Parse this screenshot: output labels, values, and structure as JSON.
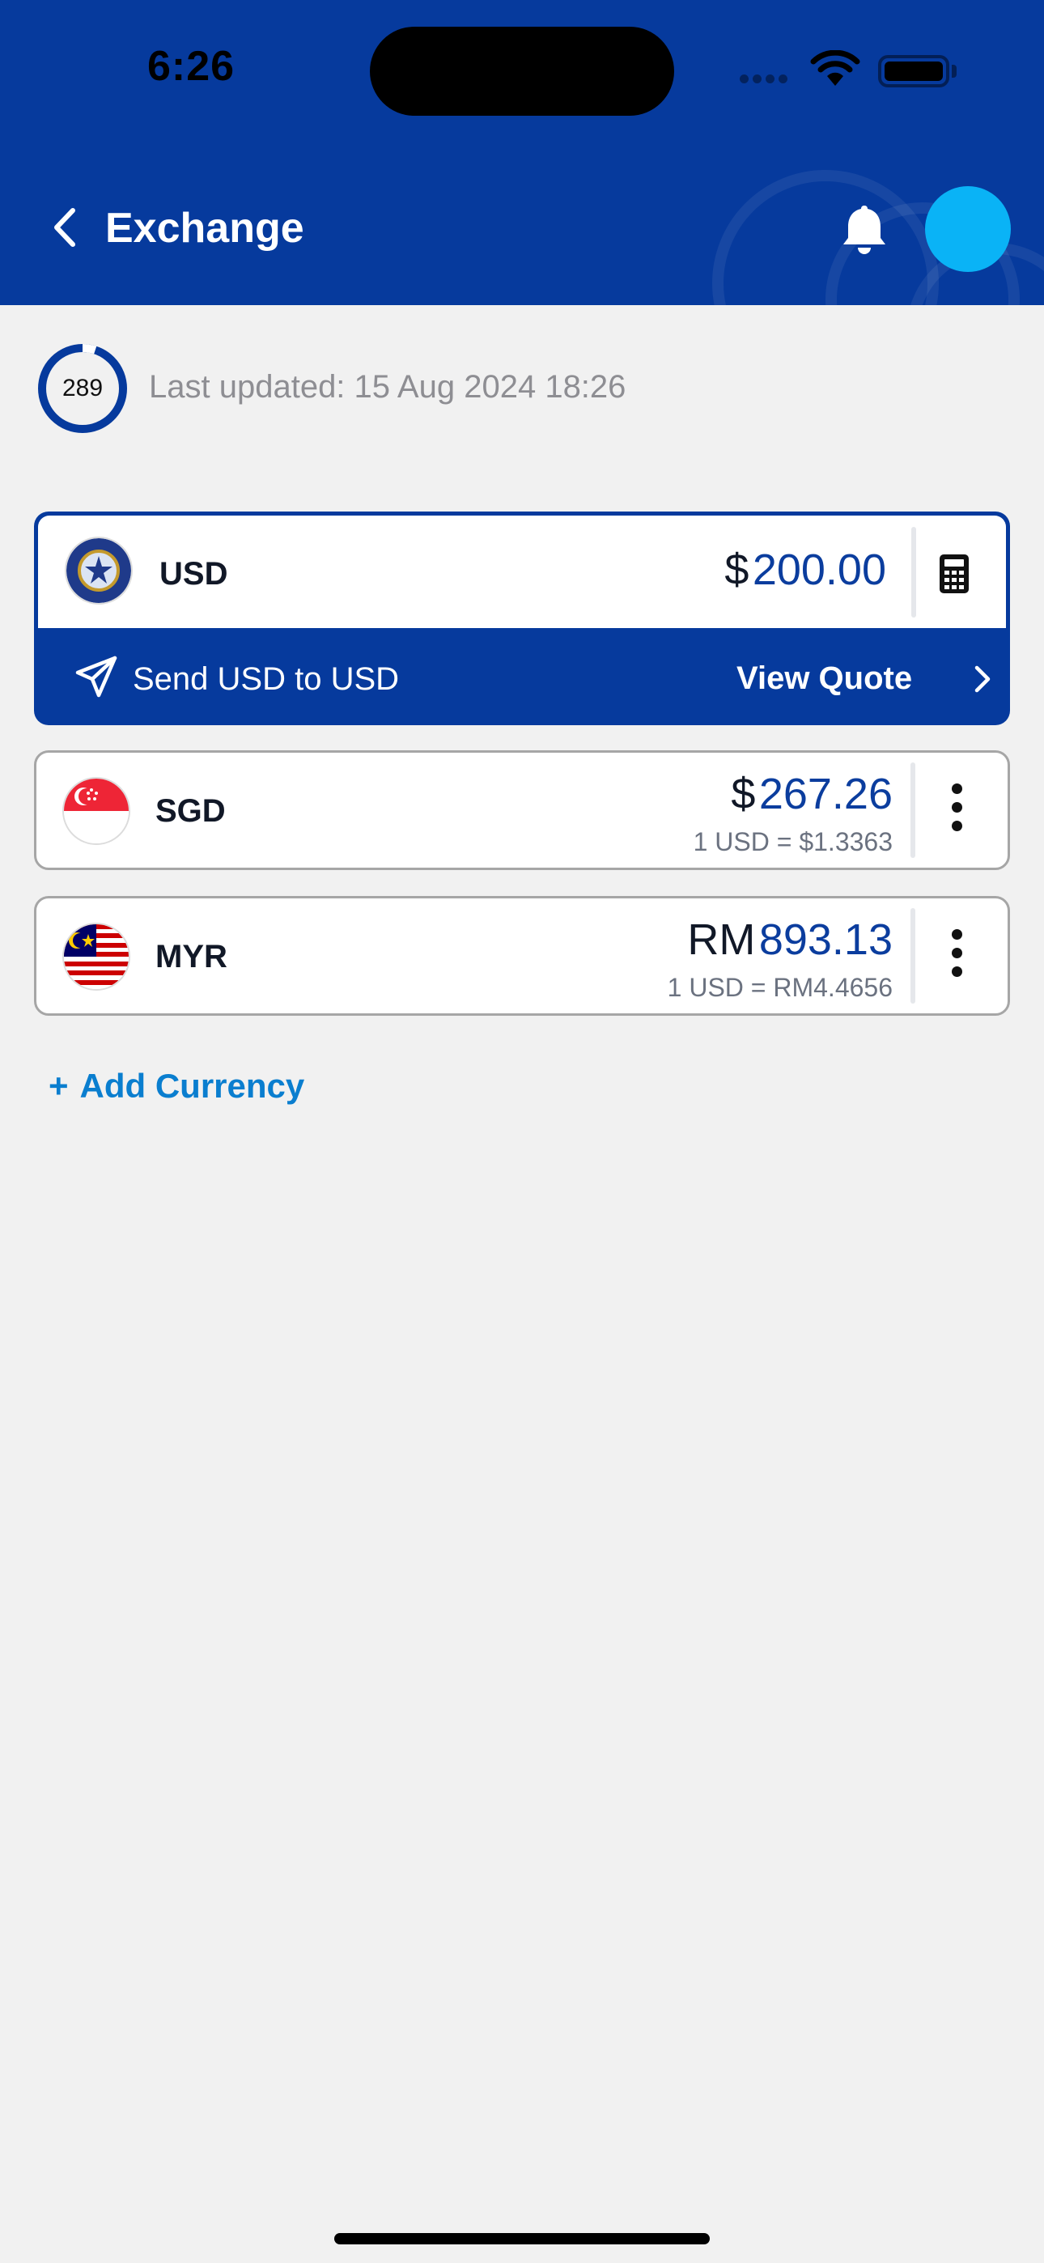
{
  "status_bar": {
    "time": "6:26"
  },
  "header": {
    "title": "Exchange"
  },
  "refresh": {
    "count": "289",
    "last_updated": "Last updated: 15 Aug 2024 18:26"
  },
  "base_currency": {
    "code": "USD",
    "symbol": "$",
    "amount": "200.00",
    "send_label": "Send USD to USD",
    "quote_label": "View Quote"
  },
  "currencies": [
    {
      "code": "SGD",
      "symbol": "$",
      "amount": "267.26",
      "rate": "1 USD = $1.3363"
    },
    {
      "code": "MYR",
      "symbol": "RM",
      "amount": "893.13",
      "rate": "1 USD = RM4.4656"
    }
  ],
  "add_currency": {
    "label": "Add Currency"
  },
  "colors": {
    "brand_blue": "#063a9d",
    "amount_blue": "#0b3d9e",
    "link_blue": "#0a7ecf",
    "avatar_cyan": "#0ab3f6"
  },
  "icons": [
    "chevron-left-icon",
    "bell-icon",
    "calculator-icon",
    "send-icon",
    "chevron-right-icon",
    "more-vertical-icon",
    "plus-icon"
  ]
}
